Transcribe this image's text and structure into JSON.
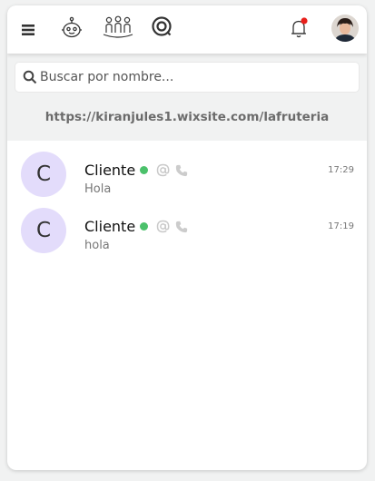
{
  "header": {
    "icons": [
      "menu-icon",
      "bot-icon",
      "team-icon",
      "chat-icon",
      "bell-icon"
    ],
    "notification_dot_color": "#e8201b"
  },
  "search": {
    "placeholder": "Buscar por nombre..."
  },
  "site": {
    "url": "https://kiranjules1.wixsite.com/lafruteria"
  },
  "conversations": [
    {
      "avatar_letter": "C",
      "name": "Cliente",
      "preview": "Hola",
      "time": "17:29",
      "online": true
    },
    {
      "avatar_letter": "C",
      "name": "Cliente",
      "preview": "hola",
      "time": "17:19",
      "online": true
    }
  ],
  "colors": {
    "online": "#4bc16b",
    "avatar_bg": "#e3dcfb",
    "panel_bg": "#f1f2f2"
  }
}
